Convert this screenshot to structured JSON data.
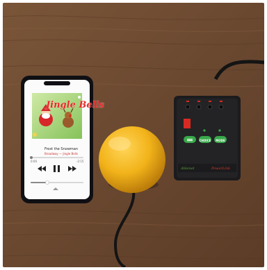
{
  "phone": {
    "album_title": "Jingle Bells",
    "song_title": "Frost the Snowman",
    "artist": "Broadway — Jingle Bells",
    "time_left": "0:00",
    "time_right": "-2:15"
  },
  "controller": {
    "center_button": "CHOICE",
    "right_button": "MODE",
    "brand_left": "Ablenet",
    "brand_right": "PowerLink"
  },
  "colors": {
    "table_wood": "#6b4a33",
    "switch_yellow": "#f2b31a",
    "controller_body": "#1b1b1d",
    "button_green": "#38a84a",
    "indicator_red": "#d92a22",
    "cable_black": "#141414"
  }
}
